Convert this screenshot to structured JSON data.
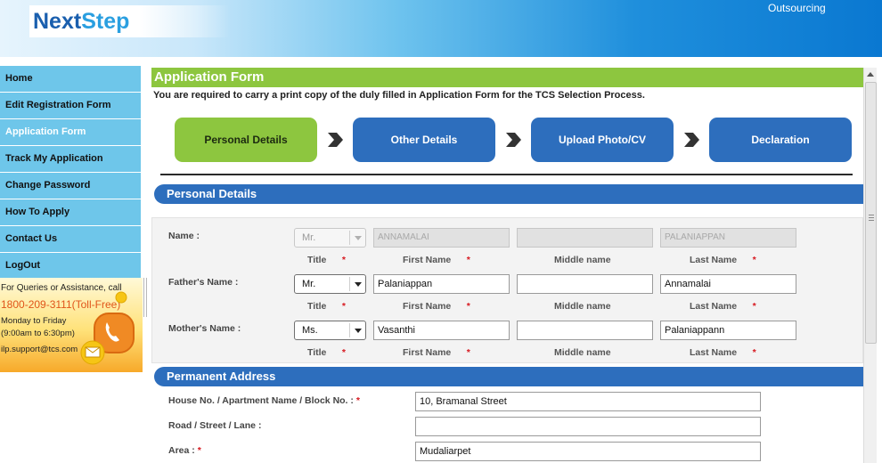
{
  "header": {
    "logo_part1": "Next",
    "logo_part2": "Step",
    "outsourcing": "Outsourcing"
  },
  "sidebar": {
    "items": [
      {
        "label": "Home"
      },
      {
        "label": "Edit Registration Form"
      },
      {
        "label": "Application Form"
      },
      {
        "label": "Track My Application"
      },
      {
        "label": "Change Password"
      },
      {
        "label": "How To Apply"
      },
      {
        "label": "Contact Us"
      },
      {
        "label": "LogOut"
      }
    ]
  },
  "help": {
    "line1": "For Queries or Assistance, call",
    "phone": "1800-209-3111(Toll-Free)",
    "days": "Monday to Friday",
    "hours": "(9:00am to 6:30pm)",
    "email": "ilp.support@tcs.com"
  },
  "form": {
    "title": "Application Form",
    "notice": "You are required to carry a print copy of the duly filled in Application Form for the TCS Selection Process."
  },
  "steps": [
    {
      "label": "Personal Details"
    },
    {
      "label": "Other Details"
    },
    {
      "label": "Upload Photo/CV"
    },
    {
      "label": "Declaration"
    }
  ],
  "sections": {
    "personal": "Personal Details",
    "address": "Permanent Address"
  },
  "columns": {
    "title": "Title",
    "first": "First Name",
    "middle": "Middle name",
    "last": "Last Name",
    "required_mark": "*"
  },
  "name_row": {
    "label": "Name :",
    "title": "Mr.",
    "first": "ANNAMALAI",
    "middle": "",
    "last": "PALANIAPPAN"
  },
  "father_row": {
    "label": "Father's Name :",
    "title": "Mr.",
    "first": "Palaniappan",
    "middle": "",
    "last": "Annamalai"
  },
  "mother_row": {
    "label": "Mother's Name :",
    "title": "Ms.",
    "first": "Vasanthi",
    "middle": "",
    "last": "Palaniappann"
  },
  "address": {
    "house_label": "House No. / Apartment Name / Block No. :",
    "house_value": "10, Bramanal Street",
    "road_label": "Road / Street / Lane :",
    "road_value": "",
    "area_label": "Area :",
    "area_value": "Mudaliarpet"
  },
  "colors": {
    "accent_green": "#8dc63f",
    "accent_blue": "#2d6ebd",
    "nav_bg": "#6ec6ea",
    "required": "#d71920"
  }
}
